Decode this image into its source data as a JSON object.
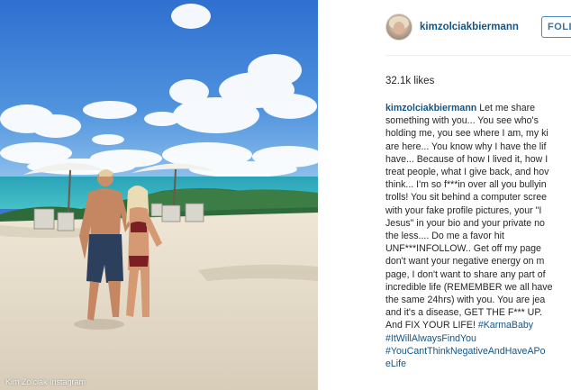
{
  "photo": {
    "alt": "Beach photo of a couple",
    "watermark": "Kim Zolciak Instagram"
  },
  "post": {
    "username": "kimzolciakbiermann",
    "follow_label": "FOLLOW",
    "likes": "32.1k likes",
    "caption_user": "kimzolciakbiermann",
    "caption_lines": [
      " Let me share",
      "something with you... You see who's",
      "holding me, you see where I am, my ki",
      "are here... You know why I have the lif",
      "have... Because of how I lived it, how I",
      "treat people, what I give back, and hov",
      "think... I'm so f***in over all you bullyin",
      "trolls! You sit behind a computer scree",
      "with your fake profile pictures, your \"I",
      "Jesus\" in your bio and your private no",
      "the less.... Do me a favor hit",
      "UNF***INFOLLOW.. Get off my page",
      "don't want your negative energy on m",
      "page, I don't want to share any part of",
      "incredible life (REMEMBER we all have",
      "the same 24hrs) with you. You are jea",
      "and it's a disease, GET THE F*** UP.",
      "And FIX YOUR LIFE! "
    ],
    "hashtags": {
      "karma": "#KarmaBaby",
      "always": "#ItWillAlwaysFindYou",
      "cant_line1": "#YouCantThinkNegativeAndHaveAPo",
      "cant_line2": "eLife"
    }
  },
  "colors": {
    "link": "#125688",
    "follow_border": "#4c87c7",
    "text": "#262626"
  }
}
